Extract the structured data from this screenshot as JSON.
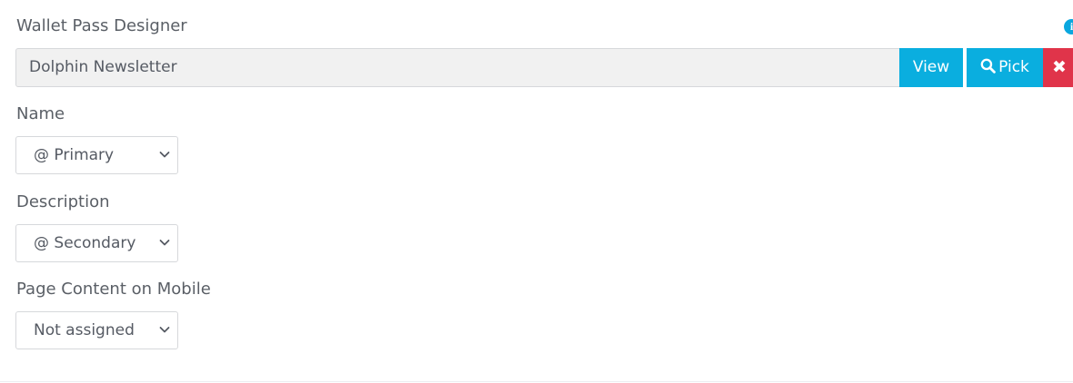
{
  "wallet_pass": {
    "label": "Wallet Pass Designer",
    "info_icon": "info-icon",
    "value": "Dolphin Newsletter",
    "view_label": "View",
    "pick_label": "Pick",
    "pick_icon": "search-icon",
    "remove_icon": "close-icon",
    "remove_glyph": "✖"
  },
  "name": {
    "label": "Name",
    "selected": "@ Primary"
  },
  "description": {
    "label": "Description",
    "selected": "@ Secondary"
  },
  "page_content_mobile": {
    "label": "Page Content on Mobile",
    "selected": "Not assigned"
  },
  "colors": {
    "primary_button": "#0aaedf",
    "danger_button": "#e0344a",
    "info_icon": "#0aa7df",
    "text": "#555a63"
  }
}
